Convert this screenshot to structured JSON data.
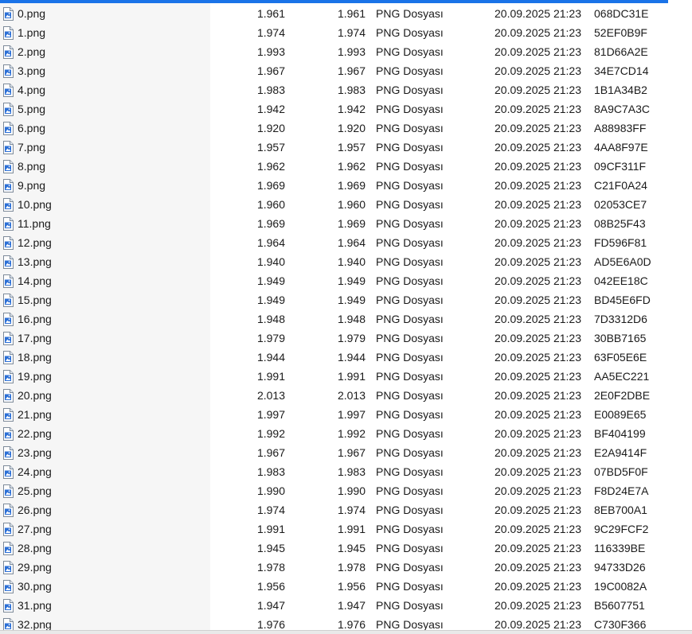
{
  "colors": {
    "accent": "#1a73e8",
    "icon_blue": "#2b6fd6"
  },
  "icon_name": "png-file-icon",
  "files": [
    {
      "name": "0.png",
      "size": "1.961",
      "packed": "1.961",
      "type": "PNG Dosyası",
      "modified": "20.09.2025 21:23",
      "crc": "068DC31E"
    },
    {
      "name": "1.png",
      "size": "1.974",
      "packed": "1.974",
      "type": "PNG Dosyası",
      "modified": "20.09.2025 21:23",
      "crc": "52EF0B9F"
    },
    {
      "name": "2.png",
      "size": "1.993",
      "packed": "1.993",
      "type": "PNG Dosyası",
      "modified": "20.09.2025 21:23",
      "crc": "81D66A2E"
    },
    {
      "name": "3.png",
      "size": "1.967",
      "packed": "1.967",
      "type": "PNG Dosyası",
      "modified": "20.09.2025 21:23",
      "crc": "34E7CD14"
    },
    {
      "name": "4.png",
      "size": "1.983",
      "packed": "1.983",
      "type": "PNG Dosyası",
      "modified": "20.09.2025 21:23",
      "crc": "1B1A34B2"
    },
    {
      "name": "5.png",
      "size": "1.942",
      "packed": "1.942",
      "type": "PNG Dosyası",
      "modified": "20.09.2025 21:23",
      "crc": "8A9C7A3C"
    },
    {
      "name": "6.png",
      "size": "1.920",
      "packed": "1.920",
      "type": "PNG Dosyası",
      "modified": "20.09.2025 21:23",
      "crc": "A88983FF"
    },
    {
      "name": "7.png",
      "size": "1.957",
      "packed": "1.957",
      "type": "PNG Dosyası",
      "modified": "20.09.2025 21:23",
      "crc": "4AA8F97E"
    },
    {
      "name": "8.png",
      "size": "1.962",
      "packed": "1.962",
      "type": "PNG Dosyası",
      "modified": "20.09.2025 21:23",
      "crc": "09CF311F"
    },
    {
      "name": "9.png",
      "size": "1.969",
      "packed": "1.969",
      "type": "PNG Dosyası",
      "modified": "20.09.2025 21:23",
      "crc": "C21F0A24"
    },
    {
      "name": "10.png",
      "size": "1.960",
      "packed": "1.960",
      "type": "PNG Dosyası",
      "modified": "20.09.2025 21:23",
      "crc": "02053CE7"
    },
    {
      "name": "11.png",
      "size": "1.969",
      "packed": "1.969",
      "type": "PNG Dosyası",
      "modified": "20.09.2025 21:23",
      "crc": "08B25F43"
    },
    {
      "name": "12.png",
      "size": "1.964",
      "packed": "1.964",
      "type": "PNG Dosyası",
      "modified": "20.09.2025 21:23",
      "crc": "FD596F81"
    },
    {
      "name": "13.png",
      "size": "1.940",
      "packed": "1.940",
      "type": "PNG Dosyası",
      "modified": "20.09.2025 21:23",
      "crc": "AD5E6A0D"
    },
    {
      "name": "14.png",
      "size": "1.949",
      "packed": "1.949",
      "type": "PNG Dosyası",
      "modified": "20.09.2025 21:23",
      "crc": "042EE18C"
    },
    {
      "name": "15.png",
      "size": "1.949",
      "packed": "1.949",
      "type": "PNG Dosyası",
      "modified": "20.09.2025 21:23",
      "crc": "BD45E6FD"
    },
    {
      "name": "16.png",
      "size": "1.948",
      "packed": "1.948",
      "type": "PNG Dosyası",
      "modified": "20.09.2025 21:23",
      "crc": "7D3312D6"
    },
    {
      "name": "17.png",
      "size": "1.979",
      "packed": "1.979",
      "type": "PNG Dosyası",
      "modified": "20.09.2025 21:23",
      "crc": "30BB7165"
    },
    {
      "name": "18.png",
      "size": "1.944",
      "packed": "1.944",
      "type": "PNG Dosyası",
      "modified": "20.09.2025 21:23",
      "crc": "63F05E6E"
    },
    {
      "name": "19.png",
      "size": "1.991",
      "packed": "1.991",
      "type": "PNG Dosyası",
      "modified": "20.09.2025 21:23",
      "crc": "AA5EC221"
    },
    {
      "name": "20.png",
      "size": "2.013",
      "packed": "2.013",
      "type": "PNG Dosyası",
      "modified": "20.09.2025 21:23",
      "crc": "2E0F2DBE"
    },
    {
      "name": "21.png",
      "size": "1.997",
      "packed": "1.997",
      "type": "PNG Dosyası",
      "modified": "20.09.2025 21:23",
      "crc": "E0089E65"
    },
    {
      "name": "22.png",
      "size": "1.992",
      "packed": "1.992",
      "type": "PNG Dosyası",
      "modified": "20.09.2025 21:23",
      "crc": "BF404199"
    },
    {
      "name": "23.png",
      "size": "1.967",
      "packed": "1.967",
      "type": "PNG Dosyası",
      "modified": "20.09.2025 21:23",
      "crc": "E2A9414F"
    },
    {
      "name": "24.png",
      "size": "1.983",
      "packed": "1.983",
      "type": "PNG Dosyası",
      "modified": "20.09.2025 21:23",
      "crc": "07BD5F0F"
    },
    {
      "name": "25.png",
      "size": "1.990",
      "packed": "1.990",
      "type": "PNG Dosyası",
      "modified": "20.09.2025 21:23",
      "crc": "F8D24E7A"
    },
    {
      "name": "26.png",
      "size": "1.974",
      "packed": "1.974",
      "type": "PNG Dosyası",
      "modified": "20.09.2025 21:23",
      "crc": "8EB700A1"
    },
    {
      "name": "27.png",
      "size": "1.991",
      "packed": "1.991",
      "type": "PNG Dosyası",
      "modified": "20.09.2025 21:23",
      "crc": "9C29FCF2"
    },
    {
      "name": "28.png",
      "size": "1.945",
      "packed": "1.945",
      "type": "PNG Dosyası",
      "modified": "20.09.2025 21:23",
      "crc": "116339BE"
    },
    {
      "name": "29.png",
      "size": "1.978",
      "packed": "1.978",
      "type": "PNG Dosyası",
      "modified": "20.09.2025 21:23",
      "crc": "94733D26"
    },
    {
      "name": "30.png",
      "size": "1.956",
      "packed": "1.956",
      "type": "PNG Dosyası",
      "modified": "20.09.2025 21:23",
      "crc": "19C0082A"
    },
    {
      "name": "31.png",
      "size": "1.947",
      "packed": "1.947",
      "type": "PNG Dosyası",
      "modified": "20.09.2025 21:23",
      "crc": "B5607751"
    },
    {
      "name": "32.png",
      "size": "1.976",
      "packed": "1.976",
      "type": "PNG Dosyası",
      "modified": "20.09.2025 21:23",
      "crc": "C730F366"
    }
  ]
}
